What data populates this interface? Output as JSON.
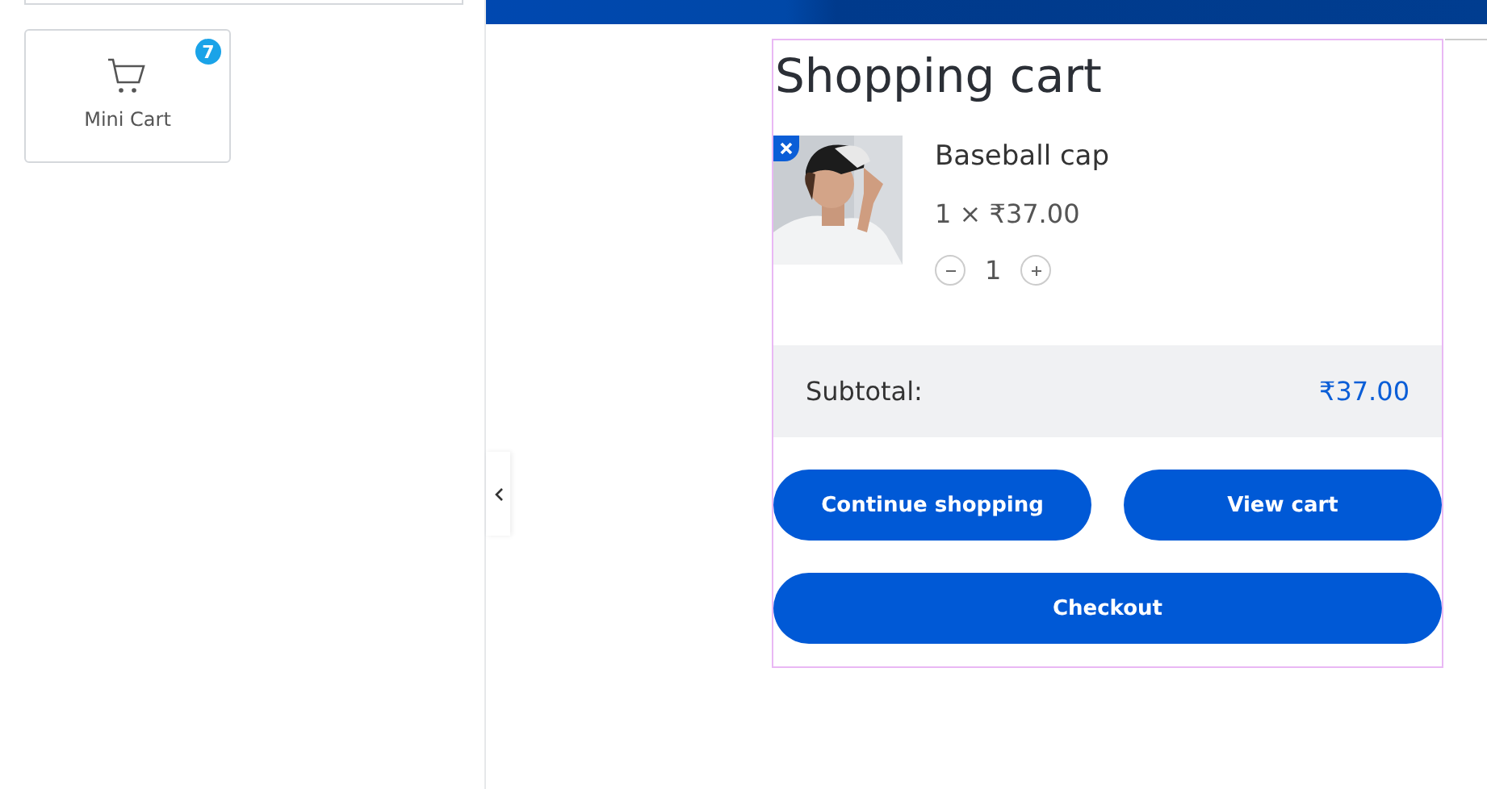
{
  "widget": {
    "label": "Mini Cart",
    "badge": "7"
  },
  "cart": {
    "title": "Shopping cart",
    "items": [
      {
        "kind": "picture",
        "name": "Baseball cap",
        "price_line": "1 × ₹37.00",
        "quantity": "1"
      }
    ],
    "subtotal": {
      "label": "Subtotal:",
      "value": "₹37.00"
    },
    "buttons": [
      {
        "label": "Continue shopping"
      },
      {
        "label": "View cart"
      },
      {
        "label": "Checkout"
      }
    ]
  }
}
